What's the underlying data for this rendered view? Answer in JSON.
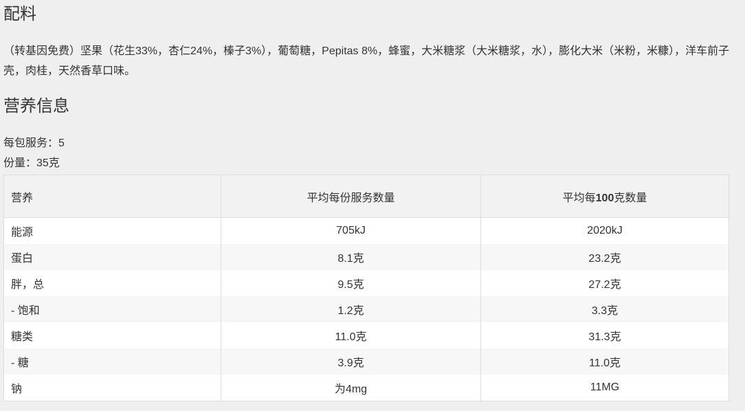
{
  "ingredients": {
    "title": "配料",
    "text": "（转基因免费）坚果（花生33%，杏仁24%，榛子3%），葡萄糖，Pepitas 8%，蜂蜜，大米糖浆（大米糖浆，水），膨化大米（米粉，米糠），洋车前子壳，肉桂，天然香草口味。"
  },
  "nutrition": {
    "title": "营养信息",
    "servings_per_pack": "每包服务：5",
    "serving_size": "份量：35克",
    "table": {
      "headers": {
        "name": "营养",
        "per_serving": "平均每份服务数量",
        "per_100g_prefix": "平均每",
        "per_100g_num": "100",
        "per_100g_suffix": "克数量"
      },
      "rows": [
        {
          "name": "能源",
          "per_serving": "705kJ",
          "per_100g": "2020kJ"
        },
        {
          "name": "蛋白",
          "per_serving": "8.1克",
          "per_100g": "23.2克"
        },
        {
          "name": "胖，总",
          "per_serving": "9.5克",
          "per_100g": "27.2克"
        },
        {
          "name": "- 饱和",
          "per_serving": "1.2克",
          "per_100g": "3.3克"
        },
        {
          "name": "糖类",
          "per_serving": "11.0克",
          "per_100g": "31.3克"
        },
        {
          "name": "- 糖",
          "per_serving": "3.9克",
          "per_100g": "11.0克"
        },
        {
          "name": "钠",
          "per_serving": "为4mg",
          "per_100g": "11MG"
        }
      ]
    }
  },
  "colors": {
    "background": "#efefef",
    "text": "#333333",
    "table_border": "#dddddd",
    "header_bg": "#f2f2f2",
    "row_odd": "#ffffff",
    "row_even": "#f7f7f7"
  }
}
